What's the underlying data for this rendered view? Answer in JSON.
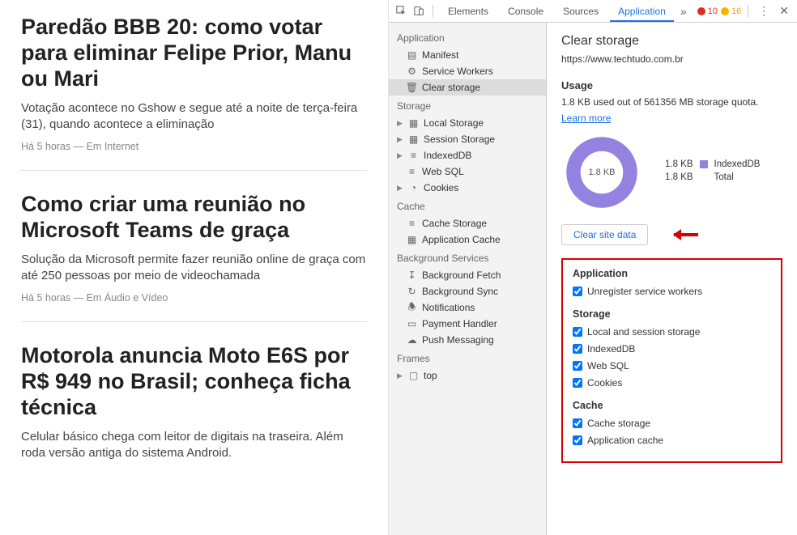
{
  "news": [
    {
      "title": "Paredão BBB 20: como votar para eliminar Felipe Prior, Manu ou Mari",
      "summary": "Votação acontece no Gshow e segue até a noite de terça-feira (31), quando acontece a eliminação",
      "meta": "Há 5 horas — Em Internet"
    },
    {
      "title": "Como criar uma reunião no Microsoft Teams de graça",
      "summary": "Solução da Microsoft permite fazer reunião online de graça com até 250 pessoas por meio de videochamada",
      "meta": "Há 5 horas — Em Áudio e Vídeo"
    },
    {
      "title": "Motorola anuncia Moto E6S por R$ 949 no Brasil; conheça ficha técnica",
      "summary": "Celular básico chega com leitor de digitais na traseira. Além roda versão antiga do sistema Android.",
      "meta": ""
    }
  ],
  "tabs": {
    "elements": "Elements",
    "console": "Console",
    "sources": "Sources",
    "application": "Application"
  },
  "counts": {
    "errors": "10",
    "warnings": "16"
  },
  "tree": {
    "application": {
      "label": "Application",
      "manifest": "Manifest",
      "service_workers": "Service Workers",
      "clear_storage": "Clear storage"
    },
    "storage": {
      "label": "Storage",
      "local": "Local Storage",
      "session": "Session Storage",
      "indexed": "IndexedDB",
      "websql": "Web SQL",
      "cookies": "Cookies"
    },
    "cache": {
      "label": "Cache",
      "cache_storage": "Cache Storage",
      "app_cache": "Application Cache"
    },
    "bg": {
      "label": "Background Services",
      "fetch": "Background Fetch",
      "sync": "Background Sync",
      "notif": "Notifications",
      "payment": "Payment Handler",
      "push": "Push Messaging"
    },
    "frames": {
      "label": "Frames",
      "top": "top"
    }
  },
  "panel": {
    "title": "Clear storage",
    "url": "https://www.techtudo.com.br",
    "usage_h": "Usage",
    "usage_text": "1.8 KB used out of 561356 MB storage quota.",
    "learn_more": "Learn more",
    "donut_center": "1.8 KB",
    "legend_db": "IndexedDB",
    "legend_total": "Total",
    "legend_size1": "1.8 KB",
    "legend_size2": "1.8 KB",
    "clear_btn": "Clear site data",
    "sec_app": "Application",
    "unreg": "Unregister service workers",
    "sec_storage": "Storage",
    "local_session": "Local and session storage",
    "idb": "IndexedDB",
    "websql": "Web SQL",
    "cookies": "Cookies",
    "sec_cache": "Cache",
    "cache_storage": "Cache storage",
    "app_cache": "Application cache"
  }
}
